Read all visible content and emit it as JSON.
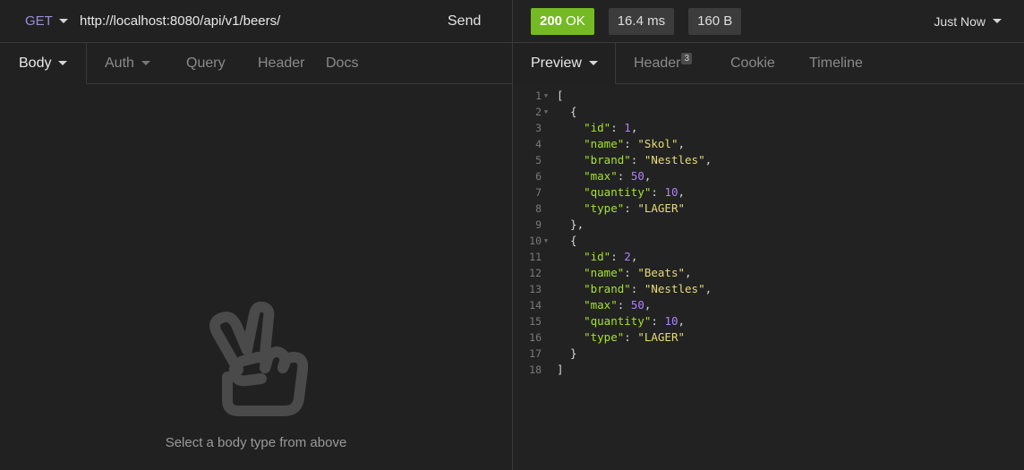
{
  "request": {
    "method": "GET",
    "url": "http://localhost:8080/api/v1/beers/",
    "send_label": "Send",
    "tabs": [
      {
        "label": "Body"
      },
      {
        "label": "Auth"
      },
      {
        "label": "Query"
      },
      {
        "label": "Header"
      },
      {
        "label": "Docs"
      }
    ],
    "empty_message": "Select a body type from above"
  },
  "response": {
    "status_code": "200",
    "status_text": "OK",
    "time": "16.4 ms",
    "size": "160 B",
    "history_label": "Just Now",
    "tabs": [
      {
        "label": "Preview"
      },
      {
        "label": "Header",
        "count": "3"
      },
      {
        "label": "Cookie"
      },
      {
        "label": "Timeline"
      }
    ]
  },
  "code_lines": [
    {
      "n": "1",
      "fold": "▼"
    },
    {
      "n": "2",
      "fold": "▼"
    },
    {
      "n": "3",
      "key": "\"id\"",
      "val": "1",
      "vtype": "n",
      "comma": ","
    },
    {
      "n": "4",
      "key": "\"name\"",
      "val": "\"Skol\"",
      "vtype": "s",
      "comma": ","
    },
    {
      "n": "5",
      "key": "\"brand\"",
      "val": "\"Nestles\"",
      "vtype": "s",
      "comma": ","
    },
    {
      "n": "6",
      "key": "\"max\"",
      "val": "50",
      "vtype": "n",
      "comma": ","
    },
    {
      "n": "7",
      "key": "\"quantity\"",
      "val": "10",
      "vtype": "n",
      "comma": ","
    },
    {
      "n": "8",
      "key": "\"type\"",
      "val": "\"LAGER\"",
      "vtype": "s",
      "comma": ""
    },
    {
      "n": "9"
    },
    {
      "n": "10",
      "fold": "▼"
    },
    {
      "n": "11",
      "key": "\"id\"",
      "val": "2",
      "vtype": "n",
      "comma": ","
    },
    {
      "n": "12",
      "key": "\"name\"",
      "val": "\"Beats\"",
      "vtype": "s",
      "comma": ","
    },
    {
      "n": "13",
      "key": "\"brand\"",
      "val": "\"Nestles\"",
      "vtype": "s",
      "comma": ","
    },
    {
      "n": "14",
      "key": "\"max\"",
      "val": "50",
      "vtype": "n",
      "comma": ","
    },
    {
      "n": "15",
      "key": "\"quantity\"",
      "val": "10",
      "vtype": "n",
      "comma": ","
    },
    {
      "n": "16",
      "key": "\"type\"",
      "val": "\"LAGER\"",
      "vtype": "s",
      "comma": ""
    },
    {
      "n": "17"
    },
    {
      "n": "18"
    }
  ],
  "code_text": {
    "open_bracket": "[",
    "open_brace_1": "  {",
    "close_brace_1": "  },",
    "open_brace_2": "  {",
    "close_brace_2": "  }",
    "close_bracket": "]"
  }
}
